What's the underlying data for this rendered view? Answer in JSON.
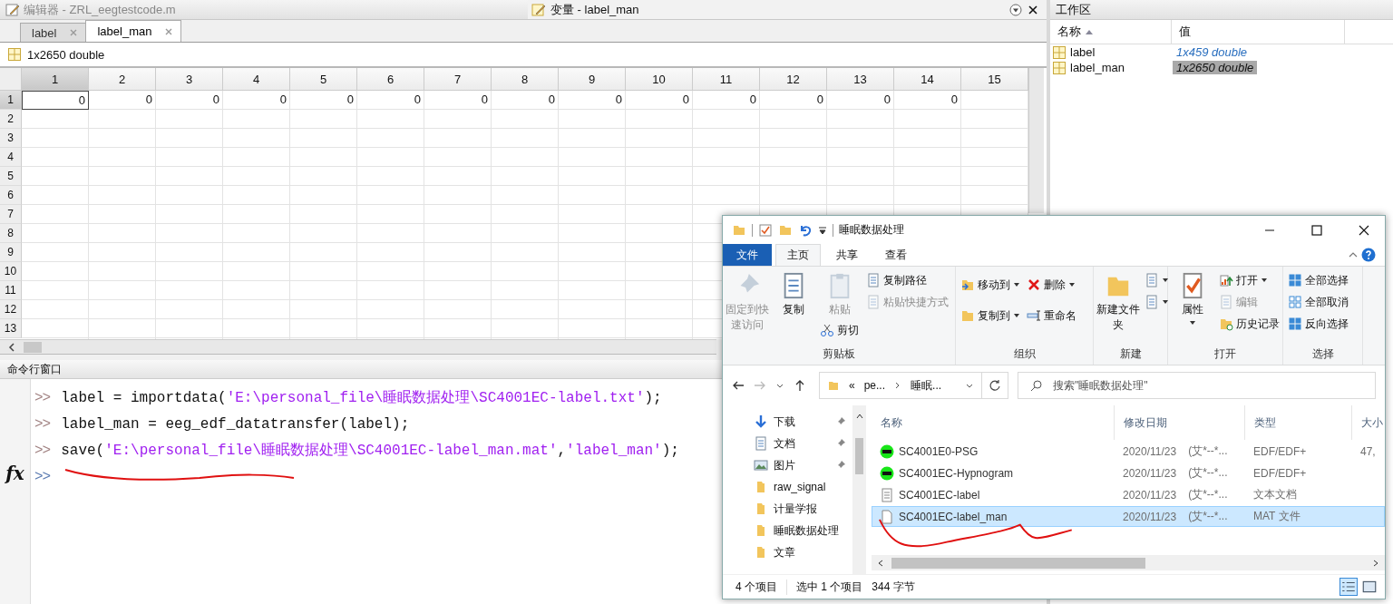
{
  "editor_bar": {
    "title": "编辑器 - ZRL_eegtestcode.m"
  },
  "variables": {
    "title": "变量 - label_man",
    "tabs": [
      {
        "label": "label",
        "selected": false
      },
      {
        "label": "label_man",
        "selected": true
      }
    ],
    "size_label": "1x2650 double",
    "columns": [
      "1",
      "2",
      "3",
      "4",
      "5",
      "6",
      "7",
      "8",
      "9",
      "10",
      "11",
      "12",
      "13",
      "14",
      "15"
    ],
    "rows": [
      {
        "header": "1",
        "selected": true,
        "cells": [
          {
            "value": "0",
            "selected": true
          },
          {
            "value": "0",
            "selected": false
          },
          {
            "value": "0",
            "selected": false
          },
          {
            "value": "0",
            "selected": false
          },
          {
            "value": "0",
            "selected": false
          },
          {
            "value": "0",
            "selected": false
          },
          {
            "value": "0",
            "selected": false
          },
          {
            "value": "0",
            "selected": false
          },
          {
            "value": "0",
            "selected": false
          },
          {
            "value": "0",
            "selected": false
          },
          {
            "value": "0",
            "selected": false
          },
          {
            "value": "0",
            "selected": false
          },
          {
            "value": "0",
            "selected": false
          },
          {
            "value": "0",
            "selected": false
          }
        ]
      },
      {
        "header": "2",
        "selected": false,
        "cells": []
      },
      {
        "header": "3",
        "selected": false,
        "cells": []
      },
      {
        "header": "4",
        "selected": false,
        "cells": []
      },
      {
        "header": "5",
        "selected": false,
        "cells": []
      },
      {
        "header": "6",
        "selected": false,
        "cells": []
      },
      {
        "header": "7",
        "selected": false,
        "cells": []
      },
      {
        "header": "8",
        "selected": false,
        "cells": []
      },
      {
        "header": "9",
        "selected": false,
        "cells": []
      },
      {
        "header": "10",
        "selected": false,
        "cells": []
      },
      {
        "header": "11",
        "selected": false,
        "cells": []
      },
      {
        "header": "12",
        "selected": false,
        "cells": []
      },
      {
        "header": "13",
        "selected": false,
        "cells": []
      }
    ]
  },
  "command_window": {
    "title": "命令行窗口",
    "lines": [
      {
        "prompt": ">>",
        "segments": [
          {
            "kind": "code",
            "text": "label = importdata("
          },
          {
            "kind": "string",
            "text": "'E:\\personal_file\\睡眠数据处理\\SC4001EC-label.txt'"
          },
          {
            "kind": "code",
            "text": ");"
          }
        ]
      },
      {
        "prompt": ">>",
        "segments": [
          {
            "kind": "code",
            "text": "label_man = eeg_edf_datatransfer(label);"
          }
        ]
      },
      {
        "prompt": ">>",
        "segments": [
          {
            "kind": "code",
            "text": "save("
          },
          {
            "kind": "string",
            "text": "'E:\\personal_file\\睡眠数据处理\\SC4001EC-label_man.mat'"
          },
          {
            "kind": "code",
            "text": ","
          },
          {
            "kind": "string",
            "text": "'label_man'"
          },
          {
            "kind": "code",
            "text": ");"
          }
        ]
      }
    ],
    "input_prompt": ">>",
    "function_button": "fx"
  },
  "workspace": {
    "title": "工作区",
    "columns": [
      {
        "label": "名称",
        "sorted": true
      },
      {
        "label": "值",
        "sorted": false
      }
    ],
    "items": [
      {
        "name": "label",
        "value": "1x459 double",
        "selected": false
      },
      {
        "name": "label_man",
        "value": "1x2650 double",
        "selected": true
      }
    ]
  },
  "explorer": {
    "title": "睡眠数据处理",
    "tabs": [
      {
        "label": "文件",
        "kind": "file",
        "selected": false
      },
      {
        "label": "主页",
        "kind": "tab",
        "selected": true
      },
      {
        "label": "共享",
        "kind": "tab",
        "selected": false
      },
      {
        "label": "查看",
        "kind": "tab",
        "selected": false
      }
    ],
    "groups": [
      {
        "label": "剪贴板",
        "columns": [
          [
            {
              "label": "固定到快速访问",
              "kind": "big",
              "disabled": true,
              "dropdown": false
            }
          ],
          [
            {
              "label": "复制",
              "kind": "big",
              "disabled": false,
              "dropdown": false
            }
          ],
          [
            {
              "label": "粘贴",
              "kind": "big",
              "disabled": true,
              "dropdown": false
            },
            {
              "label": "剪切",
              "kind": "small",
              "disabled": false,
              "dropdown": false
            }
          ],
          [
            {
              "label": "复制路径",
              "kind": "small",
              "disabled": false,
              "dropdown": false
            },
            {
              "label": "粘贴快捷方式",
              "kind": "small",
              "disabled": true,
              "dropdown": false
            }
          ]
        ]
      },
      {
        "label": "组织",
        "columns": [
          [
            {
              "label": "移动到",
              "kind": "small",
              "disabled": false,
              "dropdown": true
            },
            {
              "label": "复制到",
              "kind": "small",
              "disabled": false,
              "dropdown": true
            }
          ],
          [
            {
              "label": "删除",
              "kind": "small",
              "disabled": false,
              "dropdown": true
            },
            {
              "label": "重命名",
              "kind": "small",
              "disabled": false,
              "dropdown": false
            }
          ]
        ]
      },
      {
        "label": "新建",
        "columns": [
          [
            {
              "label": "新建文件夹",
              "kind": "big",
              "disabled": false,
              "dropdown": false
            }
          ],
          [
            {
              "kind": "icon",
              "disabled": false,
              "dropdown": true
            },
            {
              "kind": "icon",
              "disabled": false,
              "dropdown": true
            }
          ]
        ]
      },
      {
        "label": "打开",
        "columns": [
          [
            {
              "label": "属性",
              "kind": "big",
              "disabled": false,
              "dropdown": true
            }
          ],
          [
            {
              "label": "打开",
              "kind": "small",
              "disabled": false,
              "dropdown": true
            },
            {
              "label": "编辑",
              "kind": "small",
              "disabled": true,
              "dropdown": false
            },
            {
              "label": "历史记录",
              "kind": "small",
              "disabled": false,
              "dropdown": false
            }
          ]
        ]
      },
      {
        "label": "选择",
        "columns": [
          [
            {
              "label": "全部选择",
              "kind": "small",
              "disabled": false,
              "dropdown": false
            },
            {
              "label": "全部取消",
              "kind": "small",
              "disabled": false,
              "dropdown": false
            },
            {
              "label": "反向选择",
              "kind": "small",
              "disabled": false,
              "dropdown": false
            }
          ]
        ]
      }
    ],
    "address": {
      "overflow": "«",
      "crumbs": [
        "pe...",
        "睡眠..."
      ]
    },
    "search": {
      "placeholder": "搜索\"睡眠数据处理\""
    },
    "nav_items": [
      {
        "label": "下载",
        "kind": "download",
        "pinned": true
      },
      {
        "label": "文档",
        "kind": "document",
        "pinned": true
      },
      {
        "label": "图片",
        "kind": "image",
        "pinned": true
      },
      {
        "label": "raw_signal",
        "kind": "folder",
        "pinned": false
      },
      {
        "label": "计量学报",
        "kind": "folder",
        "pinned": false
      },
      {
        "label": "睡眠数据处理",
        "kind": "folder",
        "pinned": false
      },
      {
        "label": "文章",
        "kind": "folder",
        "pinned": false
      }
    ],
    "columns": [
      "名称",
      "修改日期",
      "类型",
      "大小"
    ],
    "files": [
      {
        "name": "SC4001E0-PSG",
        "kind": "edf",
        "date": "2020/11/23",
        "author": "(艾*--*...",
        "type": "EDF/EDF+",
        "size": "47,",
        "selected": false
      },
      {
        "name": "SC4001EC-Hypnogram",
        "kind": "edf",
        "date": "2020/11/23",
        "author": "(艾*--*...",
        "type": "EDF/EDF+",
        "selected": false
      },
      {
        "name": "SC4001EC-label",
        "kind": "text",
        "date": "2020/11/23",
        "author": "(艾*--*...",
        "type": "文本文档",
        "selected": false
      },
      {
        "name": "SC4001EC-label_man",
        "kind": "file",
        "date": "2020/11/23",
        "author": "(艾*--*...",
        "type": "MAT 文件",
        "selected": true
      }
    ],
    "status": [
      "4 个项目",
      "选中 1 个项目",
      "344 字节"
    ]
  }
}
